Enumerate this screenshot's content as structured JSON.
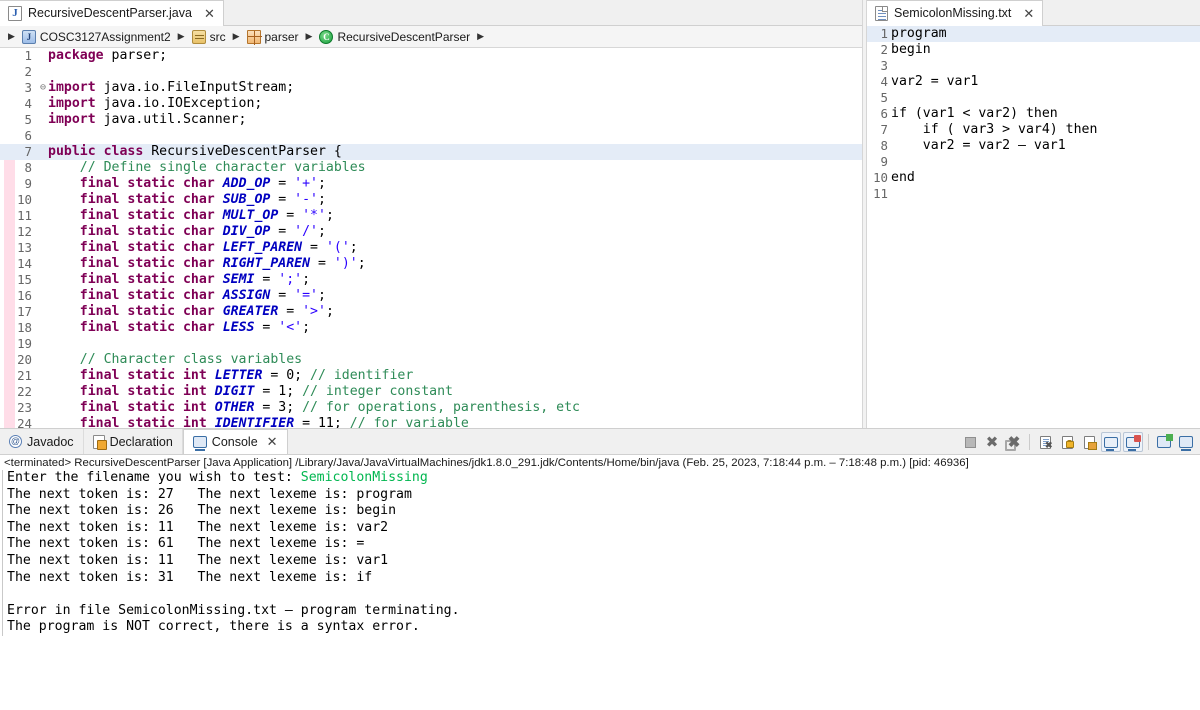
{
  "editor": {
    "tab": {
      "label": "RecursiveDescentParser.java",
      "icon": "java-file-icon",
      "close": "✕"
    },
    "breadcrumb": [
      {
        "label": "COSC3127Assignment2",
        "icon": "project-icon"
      },
      {
        "label": "src",
        "icon": "source-folder-icon"
      },
      {
        "label": "parser",
        "icon": "package-icon"
      },
      {
        "label": "RecursiveDescentParser",
        "icon": "class-icon"
      }
    ],
    "breadcrumb_separator": "▶",
    "lines": [
      {
        "n": "1",
        "fold": "",
        "parts": [
          {
            "t": "kw",
            "s": "package"
          },
          {
            "t": "p",
            "s": " parser;"
          }
        ]
      },
      {
        "n": "2",
        "fold": "",
        "parts": []
      },
      {
        "n": "3",
        "fold": "⊖",
        "parts": [
          {
            "t": "kw",
            "s": "import"
          },
          {
            "t": "p",
            "s": " java.io.FileInputStream;"
          }
        ]
      },
      {
        "n": "4",
        "fold": "",
        "parts": [
          {
            "t": "kw",
            "s": "import"
          },
          {
            "t": "p",
            "s": " java.io.IOException;"
          }
        ]
      },
      {
        "n": "5",
        "fold": "",
        "parts": [
          {
            "t": "kw",
            "s": "import"
          },
          {
            "t": "p",
            "s": " java.util.Scanner;"
          }
        ]
      },
      {
        "n": "6",
        "fold": "",
        "parts": []
      },
      {
        "n": "7",
        "fold": "",
        "hl": true,
        "parts": [
          {
            "t": "kw",
            "s": "public class"
          },
          {
            "t": "p",
            "s": " RecursiveDescentParser {"
          }
        ]
      },
      {
        "n": "8",
        "fold": "",
        "parts": [
          {
            "t": "p",
            "s": "    "
          },
          {
            "t": "cmt",
            "s": "// Define single character variables"
          }
        ]
      },
      {
        "n": "9",
        "fold": "",
        "parts": [
          {
            "t": "p",
            "s": "    "
          },
          {
            "t": "kw",
            "s": "final static char"
          },
          {
            "t": "p",
            "s": " "
          },
          {
            "t": "fld",
            "s": "ADD_OP"
          },
          {
            "t": "p",
            "s": " = "
          },
          {
            "t": "str",
            "s": "'+'"
          },
          {
            "t": "p",
            "s": ";"
          }
        ]
      },
      {
        "n": "10",
        "fold": "",
        "parts": [
          {
            "t": "p",
            "s": "    "
          },
          {
            "t": "kw",
            "s": "final static char"
          },
          {
            "t": "p",
            "s": " "
          },
          {
            "t": "fld",
            "s": "SUB_OP"
          },
          {
            "t": "p",
            "s": " = "
          },
          {
            "t": "str",
            "s": "'-'"
          },
          {
            "t": "p",
            "s": ";"
          }
        ]
      },
      {
        "n": "11",
        "fold": "",
        "parts": [
          {
            "t": "p",
            "s": "    "
          },
          {
            "t": "kw",
            "s": "final static char"
          },
          {
            "t": "p",
            "s": " "
          },
          {
            "t": "fld",
            "s": "MULT_OP"
          },
          {
            "t": "p",
            "s": " = "
          },
          {
            "t": "str",
            "s": "'*'"
          },
          {
            "t": "p",
            "s": ";"
          }
        ]
      },
      {
        "n": "12",
        "fold": "",
        "parts": [
          {
            "t": "p",
            "s": "    "
          },
          {
            "t": "kw",
            "s": "final static char"
          },
          {
            "t": "p",
            "s": " "
          },
          {
            "t": "fld",
            "s": "DIV_OP"
          },
          {
            "t": "p",
            "s": " = "
          },
          {
            "t": "str",
            "s": "'/'"
          },
          {
            "t": "p",
            "s": ";"
          }
        ]
      },
      {
        "n": "13",
        "fold": "",
        "parts": [
          {
            "t": "p",
            "s": "    "
          },
          {
            "t": "kw",
            "s": "final static char"
          },
          {
            "t": "p",
            "s": " "
          },
          {
            "t": "fld",
            "s": "LEFT_PAREN"
          },
          {
            "t": "p",
            "s": " = "
          },
          {
            "t": "str",
            "s": "'('"
          },
          {
            "t": "p",
            "s": ";"
          }
        ]
      },
      {
        "n": "14",
        "fold": "",
        "parts": [
          {
            "t": "p",
            "s": "    "
          },
          {
            "t": "kw",
            "s": "final static char"
          },
          {
            "t": "p",
            "s": " "
          },
          {
            "t": "fld",
            "s": "RIGHT_PAREN"
          },
          {
            "t": "p",
            "s": " = "
          },
          {
            "t": "str",
            "s": "')'"
          },
          {
            "t": "p",
            "s": ";"
          }
        ]
      },
      {
        "n": "15",
        "fold": "",
        "parts": [
          {
            "t": "p",
            "s": "    "
          },
          {
            "t": "kw",
            "s": "final static char"
          },
          {
            "t": "p",
            "s": " "
          },
          {
            "t": "fld",
            "s": "SEMI"
          },
          {
            "t": "p",
            "s": " = "
          },
          {
            "t": "str",
            "s": "';'"
          },
          {
            "t": "p",
            "s": ";"
          }
        ]
      },
      {
        "n": "16",
        "fold": "",
        "parts": [
          {
            "t": "p",
            "s": "    "
          },
          {
            "t": "kw",
            "s": "final static char"
          },
          {
            "t": "p",
            "s": " "
          },
          {
            "t": "fld",
            "s": "ASSIGN"
          },
          {
            "t": "p",
            "s": " = "
          },
          {
            "t": "str",
            "s": "'='"
          },
          {
            "t": "p",
            "s": ";"
          }
        ]
      },
      {
        "n": "17",
        "fold": "",
        "parts": [
          {
            "t": "p",
            "s": "    "
          },
          {
            "t": "kw",
            "s": "final static char"
          },
          {
            "t": "p",
            "s": " "
          },
          {
            "t": "fld",
            "s": "GREATER"
          },
          {
            "t": "p",
            "s": " = "
          },
          {
            "t": "str",
            "s": "'>'"
          },
          {
            "t": "p",
            "s": ";"
          }
        ]
      },
      {
        "n": "18",
        "fold": "",
        "parts": [
          {
            "t": "p",
            "s": "    "
          },
          {
            "t": "kw",
            "s": "final static char"
          },
          {
            "t": "p",
            "s": " "
          },
          {
            "t": "fld",
            "s": "LESS"
          },
          {
            "t": "p",
            "s": " = "
          },
          {
            "t": "str",
            "s": "'<'"
          },
          {
            "t": "p",
            "s": ";"
          }
        ]
      },
      {
        "n": "19",
        "fold": "",
        "parts": []
      },
      {
        "n": "20",
        "fold": "",
        "parts": [
          {
            "t": "p",
            "s": "    "
          },
          {
            "t": "cmt",
            "s": "// Character class variables"
          }
        ]
      },
      {
        "n": "21",
        "fold": "",
        "parts": [
          {
            "t": "p",
            "s": "    "
          },
          {
            "t": "kw",
            "s": "final static int"
          },
          {
            "t": "p",
            "s": " "
          },
          {
            "t": "fld",
            "s": "LETTER"
          },
          {
            "t": "p",
            "s": " = 0; "
          },
          {
            "t": "cmt",
            "s": "// identifier"
          }
        ]
      },
      {
        "n": "22",
        "fold": "",
        "parts": [
          {
            "t": "p",
            "s": "    "
          },
          {
            "t": "kw",
            "s": "final static int"
          },
          {
            "t": "p",
            "s": " "
          },
          {
            "t": "fld",
            "s": "DIGIT"
          },
          {
            "t": "p",
            "s": " = 1; "
          },
          {
            "t": "cmt",
            "s": "// integer constant"
          }
        ]
      },
      {
        "n": "23",
        "fold": "",
        "parts": [
          {
            "t": "p",
            "s": "    "
          },
          {
            "t": "kw",
            "s": "final static int"
          },
          {
            "t": "p",
            "s": " "
          },
          {
            "t": "fld",
            "s": "OTHER"
          },
          {
            "t": "p",
            "s": " = 3; "
          },
          {
            "t": "cmt",
            "s": "// for operations, parenthesis, etc"
          }
        ]
      },
      {
        "n": "24",
        "fold": "",
        "clipped": true,
        "parts": [
          {
            "t": "p",
            "s": "    "
          },
          {
            "t": "kw",
            "s": "final static int"
          },
          {
            "t": "p",
            "s": " "
          },
          {
            "t": "fld",
            "s": "IDENTIFIER"
          },
          {
            "t": "p",
            "s": " = 11; "
          },
          {
            "t": "cmt",
            "s": "// for variable"
          }
        ]
      }
    ]
  },
  "text_editor": {
    "tab": {
      "label": "SemicolonMissing.txt",
      "icon": "text-file-icon",
      "close": "✕"
    },
    "lines": [
      {
        "n": "1",
        "text": "program",
        "hl": true
      },
      {
        "n": "2",
        "text": "begin"
      },
      {
        "n": "3",
        "text": ""
      },
      {
        "n": "4",
        "text": "var2 = var1"
      },
      {
        "n": "5",
        "text": ""
      },
      {
        "n": "6",
        "text": "if (var1 < var2) then"
      },
      {
        "n": "7",
        "text": "    if ( var3 > var4) then"
      },
      {
        "n": "8",
        "text": "    var2 = var2 – var1"
      },
      {
        "n": "9",
        "text": ""
      },
      {
        "n": "10",
        "text": "end"
      },
      {
        "n": "11",
        "text": ""
      }
    ]
  },
  "console": {
    "tabs": [
      {
        "label": "Javadoc",
        "icon": "javadoc-icon",
        "active": false,
        "closable": false
      },
      {
        "label": "Declaration",
        "icon": "declaration-icon",
        "active": false,
        "closable": false
      },
      {
        "label": "Console",
        "icon": "console-icon",
        "active": true,
        "closable": true
      }
    ],
    "tab_close": "✕",
    "toolbar": [
      {
        "name": "terminate-button",
        "glyph": "stop-square-icon"
      },
      {
        "name": "remove-launch-button",
        "glyph": "x-icon"
      },
      {
        "name": "remove-all-terminated-button",
        "glyph": "xx-icon"
      },
      {
        "name": "clear-console-button",
        "glyph": "clear-console-icon"
      },
      {
        "name": "scroll-lock-button",
        "glyph": "lock-icon"
      },
      {
        "name": "word-wrap-button",
        "glyph": "pin-console-icon"
      },
      {
        "name": "show-console-stdout-button",
        "glyph": "console-out-icon"
      },
      {
        "name": "show-console-stderr-button",
        "glyph": "console-err-icon"
      },
      {
        "name": "open-console-button",
        "glyph": "new-console-icon"
      },
      {
        "name": "display-selected-console-button",
        "glyph": "display-console-icon"
      }
    ],
    "header": "<terminated> RecursiveDescentParser [Java Application] /Library/Java/JavaVirtualMachines/jdk1.8.0_291.jdk/Contents/Home/bin/java  (Feb. 25, 2023, 7:18:44 p.m. – 7:18:48 p.m.) [pid: 46936]",
    "output": [
      {
        "segments": [
          {
            "t": "plain",
            "s": "Enter the filename you wish to test: "
          },
          {
            "t": "input",
            "s": "SemicolonMissing"
          }
        ]
      },
      {
        "segments": [
          {
            "t": "plain",
            "s": "The next token is: 27   The next lexeme is: program"
          }
        ]
      },
      {
        "segments": [
          {
            "t": "plain",
            "s": "The next token is: 26   The next lexeme is: begin"
          }
        ]
      },
      {
        "segments": [
          {
            "t": "plain",
            "s": "The next token is: 11   The next lexeme is: var2"
          }
        ]
      },
      {
        "segments": [
          {
            "t": "plain",
            "s": "The next token is: 61   The next lexeme is: ="
          }
        ]
      },
      {
        "segments": [
          {
            "t": "plain",
            "s": "The next token is: 11   The next lexeme is: var1"
          }
        ]
      },
      {
        "segments": [
          {
            "t": "plain",
            "s": "The next token is: 31   The next lexeme is: if"
          }
        ]
      },
      {
        "segments": [
          {
            "t": "plain",
            "s": ""
          }
        ]
      },
      {
        "segments": [
          {
            "t": "plain",
            "s": "Error in file SemicolonMissing.txt – program terminating."
          }
        ]
      },
      {
        "segments": [
          {
            "t": "plain",
            "s": "The program is NOT correct, there is a syntax error."
          }
        ]
      }
    ]
  },
  "colors": {
    "keyword": "#7f0055",
    "comment": "#2e8b57",
    "string": "#2a00ff",
    "field": "#0000c0",
    "console_input": "#00b64f",
    "current_line": "#e4ecf7",
    "change_bar": "#ffd7e4"
  }
}
